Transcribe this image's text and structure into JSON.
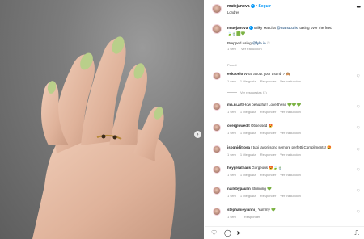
{
  "header": {
    "username": "matejanova",
    "follow_label": "Seguir",
    "location": "Londres",
    "more_icon": "more-horizontal-icon"
  },
  "caption": {
    "username": "matejanova",
    "text_before": "Milky Matcha ",
    "mention": "@manucurist",
    "text_after": " taking over the feed",
    "emojis": "🍃🍵🟩💚",
    "line2_before": "Prepped using ",
    "line2_mention": "@fyle.io",
    "line2_after": " ♡",
    "time": "1 sem",
    "see_translation": "Ver traducción"
  },
  "for_you_label": "Para ti",
  "comments": [
    {
      "user": "eskaoelo",
      "text": "What about your thumb ? 🙈",
      "time": "1 sem",
      "likes": "1 Me gusta",
      "reply": "Responder",
      "translate": "Ver traducción"
    },
    {
      "user": "ma.ni.art",
      "text": "How beautiful!! Love these 💚💚💚",
      "time": "1 sem",
      "likes": "1 Me gusta",
      "reply": "Responder",
      "translate": "Ver traducción"
    },
    {
      "user": "overglowedit",
      "text": "Obsessed 😍",
      "time": "1 sem",
      "likes": "1 Me gusta",
      "reply": "Responder",
      "translate": "Ver traducción"
    },
    {
      "user": "isognidittosa",
      "text": "I tuoi lavori sono sempre perfetti.Compliments! 😍",
      "time": "1 sem",
      "likes": "1 Me gusta",
      "reply": "Responder",
      "translate": "Ver traducción"
    },
    {
      "user": "heygreatnails",
      "text": "Gorgeous 😍🍃🍵",
      "time": "1 sem",
      "likes": "1 Me gusta",
      "reply": "Responder",
      "translate": "Ver traducción"
    },
    {
      "user": "nailsbypaulin",
      "text": "Stunning 💚",
      "time": "1 sem",
      "likes": "1 Me gusta",
      "reply": "Responder",
      "translate": "Ver traducción"
    },
    {
      "user": "stephanieyianni_",
      "text": "Yummy 💚",
      "time": "1 sem",
      "likes": "",
      "reply": "Responder",
      "translate": ""
    }
  ],
  "view_replies_label": "Ver respuestas (1)",
  "footer": {
    "icons": [
      "heart-icon",
      "comment-icon",
      "share-icon",
      "save-icon"
    ]
  },
  "colors": {
    "accent": "#0095f6",
    "nail": "#b9cf8a",
    "skin": "#e2b79e"
  }
}
